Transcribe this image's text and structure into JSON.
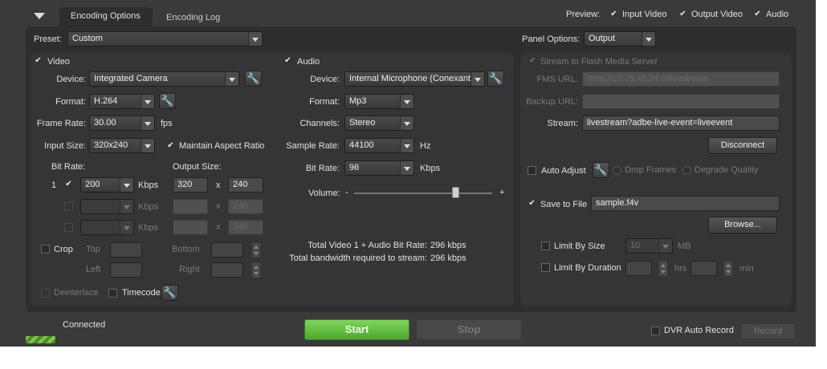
{
  "tabs": [
    {
      "label": "Encoding Options",
      "active": true
    },
    {
      "label": "Encoding Log",
      "active": false
    }
  ],
  "preview": {
    "label": "Preview:",
    "options": [
      {
        "label": "Input Video",
        "checked": true
      },
      {
        "label": "Output Video",
        "checked": true
      },
      {
        "label": "Audio",
        "checked": true
      }
    ]
  },
  "preset": {
    "label": "Preset:",
    "value": "Custom"
  },
  "panel_options": {
    "label": "Panel Options:",
    "value": "Output"
  },
  "video": {
    "label": "Video",
    "checked": true,
    "device_label": "Device:",
    "device": "Integrated Camera",
    "format_label": "Format:",
    "format": "H.264",
    "framerate_label": "Frame Rate:",
    "framerate": "30.00",
    "fps_unit": "fps",
    "inputsize_label": "Input Size:",
    "inputsize": "320x240",
    "maintain_aspect": "Maintain Aspect Ratio",
    "bitrate_label": "Bit Rate:",
    "outputsize_label": "Output Size:",
    "rows": [
      {
        "index": "1",
        "checked": true,
        "bitrate": "200",
        "unit": "Kbps",
        "width": "320",
        "x": "x",
        "height": "240"
      },
      {
        "index": "",
        "checked": false,
        "bitrate": "",
        "unit": "Kbps",
        "width": "",
        "x": "x",
        "height": "240"
      },
      {
        "index": "",
        "checked": false,
        "bitrate": "",
        "unit": "Kbps",
        "width": "",
        "x": "x",
        "height": "240"
      }
    ],
    "crop_label": "Crop",
    "top_label": "Top",
    "bottom_label": "Bottom",
    "left_label": "Left",
    "right_label": "Right",
    "deinterlace_label": "Deinterlace",
    "timecode_label": "Timecode"
  },
  "audio": {
    "label": "Audio",
    "checked": true,
    "device_label": "Device:",
    "device": "Internal Microphone (Conexant",
    "format_label": "Format:",
    "format": "Mp3",
    "channels_label": "Channels:",
    "channels": "Stereo",
    "samplerate_label": "Sample Rate:",
    "samplerate": "44100",
    "hz": "Hz",
    "bitrate_label": "Bit Rate:",
    "bitrate": "96",
    "kbps": "Kbps",
    "volume_label": "Volume:",
    "volume_minus": "-",
    "volume_plus": "+",
    "volume_level": 0.75
  },
  "totals": {
    "line1_label": "Total Video 1 + Audio Bit Rate:",
    "line1_value": "296 kbps",
    "line2_label": "Total bandwidth required to stream:",
    "line2_value": "296 kbps"
  },
  "output": {
    "stream_fms_label": "Stream to Flash Media Server",
    "stream_fms_checked": true,
    "fms_url_label": "FMS URL:",
    "fms_url": "rtmp://10.78.48.24:8/livestream",
    "backup_url_label": "Backup URL:",
    "backup_url": "",
    "stream_label": "Stream:",
    "stream": "livestream?adbe-live-event=liveevent",
    "disconnect": "Disconnect",
    "auto_adjust": "Auto Adjust",
    "drop_frames": "Drop Frames",
    "degrade_quality": "Degrade Quality",
    "save_to_file": "Save to File",
    "save_checked": true,
    "file": "sample.f4v",
    "browse": "Browse...",
    "limit_size": "Limit By Size",
    "limit_size_value": "10",
    "mb": "MB",
    "limit_duration": "Limit By Duration",
    "hrs": "hrs",
    "min": "min"
  },
  "status": {
    "connected": "Connected",
    "start": "Start",
    "stop": "Stop",
    "dvr": "DVR Auto Record",
    "record": "Record"
  },
  "colors": {
    "start_green": "#5bb83a",
    "panel_bg": "#2e2e2e",
    "app_bg": "#3a3a3a"
  }
}
